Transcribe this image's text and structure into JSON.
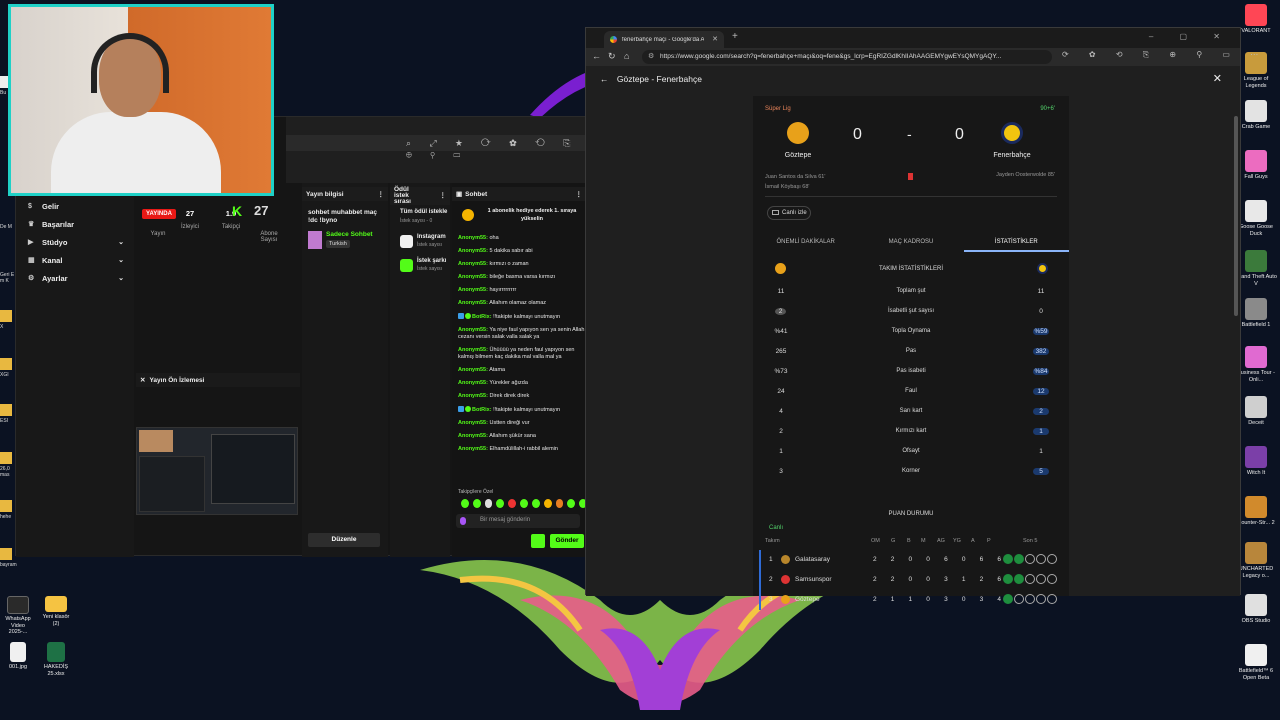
{
  "dashboard": {
    "nav": [
      {
        "label": "Gelir",
        "icon": "dollar-icon",
        "chev": false
      },
      {
        "label": "Başarılar",
        "icon": "trophy-icon",
        "chev": false
      },
      {
        "label": "Stüdyo",
        "icon": "studio-icon",
        "chev": true
      },
      {
        "label": "Kanal",
        "icon": "channel-icon",
        "chev": true
      },
      {
        "label": "Ayarlar",
        "icon": "gear-icon",
        "chev": true
      }
    ],
    "live_label": "YAYINDA",
    "stream_label": "Yayın",
    "viewers": "27",
    "viewers_label": "İzleyici",
    "followers": "1.9",
    "followers_label": "Takipçi",
    "subs_label": "Abone Sayısı",
    "kick_logo": "K",
    "kick_count": "27",
    "preview_title": "Yayın Ön İzlemesi",
    "info_header": "Yayın bilgisi",
    "stream_title": "sohbet muhabbet maç !dc !byno",
    "category": "Sadece Sohbet",
    "tag": "Turkish",
    "edit_label": "Düzenle",
    "requests_header": "Ödül istek sırası",
    "requests_title": "Tüm ödül istekle",
    "requests_sub": "İstek sayısı - 0",
    "requests": [
      {
        "name": "Instagram",
        "sub": "İstek sayısı"
      },
      {
        "name": "İstek şarkı",
        "sub": "İstek sayısı"
      }
    ],
    "chat_header": "Sohbet",
    "pinned": "1 abonelik hediye ederek 1. sıraya yükselin",
    "messages": [
      {
        "user": "Anonym55:",
        "text": "oha",
        "bot": false
      },
      {
        "user": "Anonym55:",
        "text": "5 dakika sabır abi",
        "bot": false
      },
      {
        "user": "Anonym55:",
        "text": "kırmızı o zaman",
        "bot": false
      },
      {
        "user": "Anonym55:",
        "text": "bileğe basma varsa kırmızı",
        "bot": false
      },
      {
        "user": "Anonym55:",
        "text": "hayırrrrrrrrr",
        "bot": false
      },
      {
        "user": "Anonym55:",
        "text": "Allahım olamaz olamaz",
        "bot": false
      },
      {
        "user": "BotRix:",
        "text": "!!takipte kalmayı unutmayın",
        "bot": true
      },
      {
        "user": "Anonym55:",
        "text": "Ya niye faul yapıyon sen ya senin Allah cezanı versin salak valla salak ya",
        "bot": false
      },
      {
        "user": "Anonym55:",
        "text": "Ühüüüü ya neden faul yapıyon sen kalmış bilmem kaç dakika mal valla mal ya",
        "bot": false
      },
      {
        "user": "Anonym55:",
        "text": "Atama",
        "bot": false
      },
      {
        "user": "Anonym55:",
        "text": "Yürekler ağızda",
        "bot": false
      },
      {
        "user": "Anonym55:",
        "text": "Direk direk direk",
        "bot": false
      },
      {
        "user": "BotRix:",
        "text": "!!takipte kalmayı unutmayın",
        "bot": true
      },
      {
        "user": "Anonym55:",
        "text": "Ustten direği vur",
        "bot": false
      },
      {
        "user": "Anonym55:",
        "text": "Allahım şükür sana",
        "bot": false
      },
      {
        "user": "Anonym55:",
        "text": "Elhamdülillah-i rabbil alemin",
        "bot": false
      }
    ],
    "emotes_label": "Takipçilere Özel",
    "chat_placeholder": "Bir mesaj gönderin",
    "send_label": "Gönder"
  },
  "browser": {
    "tab_title": "fenerbahçe maçı - Google'da Ara",
    "url": "https://www.google.com/search?q=fenerbahçe+maçı&oq=fene&gs_lcrp=EgRIZGdlKhIIAhAAGEMYgwEYsQMYgAQY...",
    "page_title": "Göztepe - Fenerbahçe",
    "league": "Süper Lig",
    "minute": "90+6'",
    "home": {
      "name": "Göztepe",
      "score": "0",
      "color": "#e8a11a"
    },
    "away": {
      "name": "Fenerbahçe",
      "score": "0",
      "color": "#f1c40f"
    },
    "score_sep": "-",
    "home_cards": [
      "Juan Santos da Silva 61'",
      "İsmail Köybaşı 68'"
    ],
    "away_cards": "Jayden Oosterwolde 85'",
    "watch_label": "Canlı izle",
    "tabs": [
      "ÖNEMLİ DAKİKALAR",
      "MAÇ KADROSU",
      "İSTATİSTİKLER"
    ],
    "stats_title": "TAKIM İSTATİSTİKLERİ",
    "stats": [
      {
        "label": "Toplam şut",
        "home": "11",
        "away": "11",
        "away_hl": false,
        "home_circ": false
      },
      {
        "label": "İsabetli şut sayısı",
        "home": "2",
        "away": "0",
        "away_hl": false,
        "home_circ": true
      },
      {
        "label": "Topla Oynama",
        "home": "%41",
        "away": "%59",
        "away_hl": true,
        "home_circ": false
      },
      {
        "label": "Pas",
        "home": "265",
        "away": "382",
        "away_hl": true,
        "home_circ": false
      },
      {
        "label": "Pas isabeti",
        "home": "%73",
        "away": "%84",
        "away_hl": true,
        "home_circ": false
      },
      {
        "label": "Faul",
        "home": "24",
        "away": "12",
        "away_hl": true,
        "home_circ": false
      },
      {
        "label": "Sarı kart",
        "home": "4",
        "away": "2",
        "away_hl": true,
        "home_circ": false
      },
      {
        "label": "Kırmızı kart",
        "home": "2",
        "away": "1",
        "away_hl": true,
        "home_circ": false
      },
      {
        "label": "Ofsayt",
        "home": "1",
        "away": "1",
        "away_hl": false,
        "home_circ": false
      },
      {
        "label": "Korner",
        "home": "3",
        "away": "5",
        "away_hl": true,
        "home_circ": false
      }
    ],
    "table_title": "PUAN DURUMU",
    "live_label": "Canlı",
    "table_headers": [
      "Takım",
      "OM",
      "G",
      "B",
      "M",
      "AG",
      "YG",
      "A",
      "P",
      "Son 5"
    ],
    "table_rows": [
      {
        "pos": "1",
        "name": "Galatasaray",
        "nums": [
          "2",
          "2",
          "0",
          "0",
          "6",
          "0",
          "6",
          "6"
        ],
        "color": "#b8862b",
        "wins": 2
      },
      {
        "pos": "2",
        "name": "Samsunspor",
        "nums": [
          "2",
          "2",
          "0",
          "0",
          "3",
          "1",
          "2",
          "6"
        ],
        "color": "#d33",
        "wins": 2
      },
      {
        "pos": "3",
        "name": "Göztepe",
        "nums": [
          "2",
          "1",
          "1",
          "0",
          "3",
          "0",
          "3",
          "4"
        ],
        "color": "#e8a11a",
        "wins": 1
      }
    ]
  },
  "desktop": {
    "right_icons": [
      {
        "label": "VALORANT",
        "color": "#ff4655"
      },
      {
        "label": "League of Legends",
        "color": "#c89b3c"
      },
      {
        "label": "Crab Game",
        "color": "#e3e3e3"
      },
      {
        "label": "Fall Guys",
        "color": "#ec6cc0"
      },
      {
        "label": "Goose Goose Duck",
        "color": "#e8e8e8"
      },
      {
        "label": "Grand Theft Auto V",
        "color": "#3b7a3b"
      },
      {
        "label": "Battlefield 1",
        "color": "#8a8a8a"
      },
      {
        "label": "Business Tour - Onli...",
        "color": "#e06ad1"
      },
      {
        "label": "Deceit",
        "color": "#cfcfcf"
      },
      {
        "label": "Witch It",
        "color": "#7b3fa8"
      },
      {
        "label": "Counter-Str... 2",
        "color": "#d18a2c"
      },
      {
        "label": "UNCHARTED Legacy o...",
        "color": "#b8863b"
      },
      {
        "label": "OBS Studio",
        "color": "#e0e0e0"
      },
      {
        "label": "Battlefield™ 6 Open Beta",
        "color": "#f0f0f0"
      }
    ],
    "bottom_icons": [
      {
        "label": "WhatsApp Video 2025-...",
        "color": "#2a2a2a"
      },
      {
        "label": "Yeni klasör (2)",
        "color": "#f5c342"
      },
      {
        "label": "001.jpg",
        "color": "#f0f0f0"
      },
      {
        "label": "HAKEDİŞ 25.xlsx",
        "color": "#1e7145"
      }
    ],
    "left_labels": [
      "Bu",
      "De M",
      "Geri E m K",
      "X",
      "XGI",
      "ESI",
      "26,0 mas",
      "hehe",
      "bayram"
    ]
  }
}
